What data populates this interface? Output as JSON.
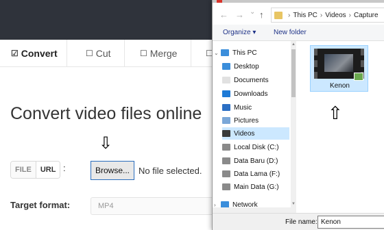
{
  "page": {
    "tabs": [
      {
        "icon": "☑",
        "label": "Convert",
        "active": true
      },
      {
        "icon": "☐",
        "label": "Cut",
        "active": false
      },
      {
        "icon": "☐",
        "label": "Merge",
        "active": false
      },
      {
        "icon": "☐",
        "label": "",
        "active": false
      }
    ],
    "heading": "Convert video files online",
    "source_toggle": {
      "file": "FILE",
      "url": "URL"
    },
    "colon": ":",
    "browse_label": "Browse...",
    "no_file_text": "No file selected.",
    "arrow_down": "⇩",
    "target_label": "Target format:",
    "format_value": "MP4"
  },
  "dialog": {
    "breadcrumb": [
      "This PC",
      "Videos",
      "Capture"
    ],
    "nav_back": "←",
    "nav_forward": "→",
    "nav_recent": "⌄",
    "nav_up": "↑",
    "organize_label": "Organize ▾",
    "new_folder_label": "New folder",
    "nav_items": [
      {
        "label": "This PC",
        "icon_color": "#3b8edb",
        "caret": "⌄",
        "selected": false
      },
      {
        "label": "Desktop",
        "icon_color": "#3b8edb",
        "caret": "",
        "selected": false
      },
      {
        "label": "Documents",
        "icon_color": "#e1e1e1",
        "caret": "",
        "selected": false
      },
      {
        "label": "Downloads",
        "icon_color": "#1e7ad6",
        "caret": "",
        "selected": false
      },
      {
        "label": "Music",
        "icon_color": "#2b6fc4",
        "caret": "",
        "selected": false
      },
      {
        "label": "Pictures",
        "icon_color": "#7aa7d8",
        "caret": "",
        "selected": false
      },
      {
        "label": "Videos",
        "icon_color": "#3a3a3a",
        "caret": "",
        "selected": true
      },
      {
        "label": "Local Disk (C:)",
        "icon_color": "#8a8a8a",
        "caret": "",
        "selected": false
      },
      {
        "label": "Data Baru (D:)",
        "icon_color": "#8a8a8a",
        "caret": "",
        "selected": false
      },
      {
        "label": "Data Lama (F:)",
        "icon_color": "#8a8a8a",
        "caret": "",
        "selected": false
      },
      {
        "label": "Main Data (G:)",
        "icon_color": "#8a8a8a",
        "caret": "",
        "selected": false
      },
      {
        "label": "Network",
        "icon_color": "#3b8edb",
        "caret": "›",
        "selected": false
      }
    ],
    "file": {
      "name": "Kenon"
    },
    "arrow_up": "⇧",
    "filename_label": "File name:",
    "filename_value": "Kenon"
  }
}
